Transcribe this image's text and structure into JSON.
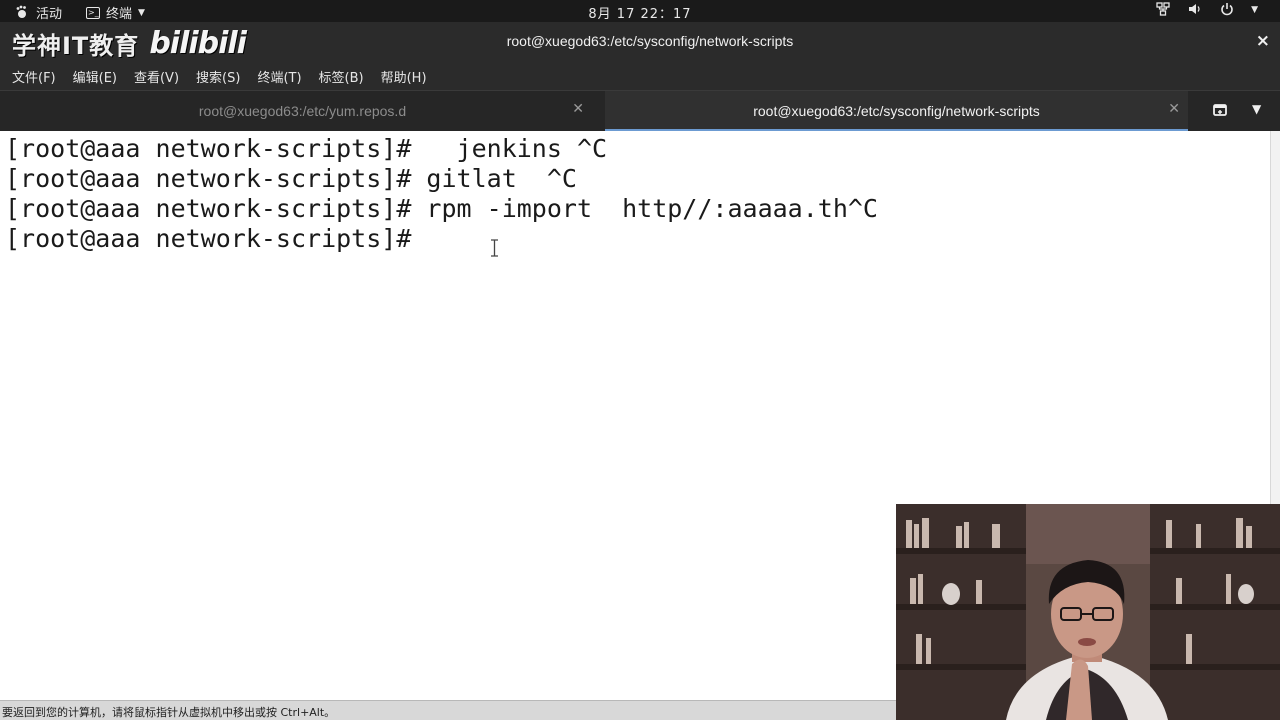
{
  "topbar": {
    "activities_label": "活动",
    "app_label": "终端",
    "clock": "8月 17  22：17",
    "system_icons": [
      "network-icon",
      "volume-icon",
      "power-icon"
    ]
  },
  "window": {
    "watermark_text": "学神IT教育",
    "watermark_logo": "bilibili",
    "title": "root@xuegod63:/etc/sysconfig/network-scripts",
    "close_glyph": "×"
  },
  "menubar": {
    "items": [
      "文件(F)",
      "编辑(E)",
      "查看(V)",
      "搜索(S)",
      "终端(T)",
      "标签(B)",
      "帮助(H)"
    ]
  },
  "tabs": [
    {
      "label": "root@xuegod63:/etc/yum.repos.d",
      "active": false
    },
    {
      "label": "root@xuegod63:/etc/sysconfig/network-scripts",
      "active": true
    }
  ],
  "terminal": {
    "lines": [
      "[root@aaa network-scripts]#   jenkins ^C",
      "[root@aaa network-scripts]# gitlat  ^C",
      "[root@aaa network-scripts]# rpm -import  http//:aaaaa.th^C",
      "[root@aaa network-scripts]# "
    ]
  },
  "statusbar": {
    "hint": "要返回到您的计算机，请将鼠标指针从虚拟机中移出或按 Ctrl+Alt。"
  },
  "colors": {
    "terminal_bg": "#ffffff",
    "terminal_fg": "#1a1a1a",
    "chrome_bg": "#2b2b2b",
    "active_tab_accent": "#6c9bd2"
  }
}
